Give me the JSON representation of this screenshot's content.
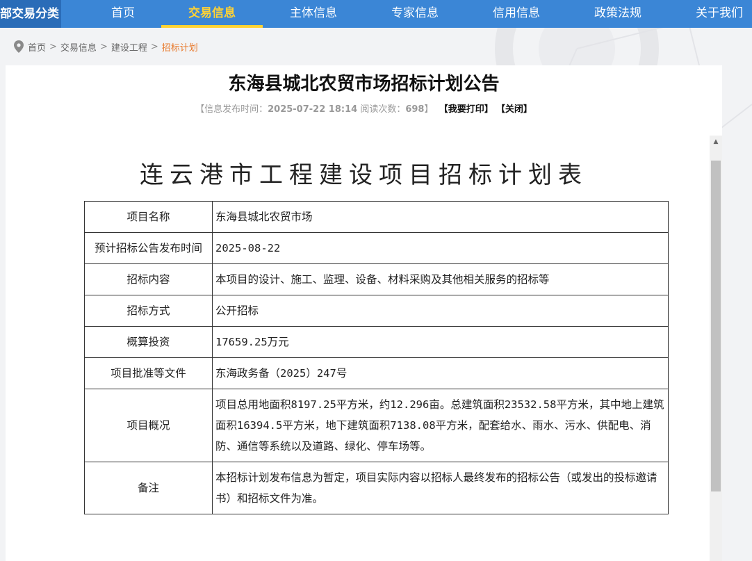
{
  "nav": {
    "category": "部交易分类",
    "items": [
      {
        "label": "首页",
        "active": false
      },
      {
        "label": "交易信息",
        "active": true
      },
      {
        "label": "主体信息",
        "active": false
      },
      {
        "label": "专家信息",
        "active": false
      },
      {
        "label": "信用信息",
        "active": false
      },
      {
        "label": "政策法规",
        "active": false
      },
      {
        "label": "关于我们",
        "active": false
      }
    ]
  },
  "breadcrumb": {
    "items": [
      "首页",
      "交易信息",
      "建设工程"
    ],
    "current": "招标计划",
    "separator": ">"
  },
  "article": {
    "title": "东海县城北农贸市场招标计划公告",
    "meta_open": "【",
    "publish_label": "信息发布时间：",
    "publish_time": "2025-07-22 18:14",
    "views_label": "阅读次数：",
    "views": "698",
    "meta_close": "】",
    "print_button": "【我要打印】",
    "close_button": "【关闭】"
  },
  "document": {
    "heading": "连云港市工程建设项目招标计划表",
    "rows": [
      {
        "key": "项目名称",
        "value": "东海县城北农贸市场"
      },
      {
        "key": "预计招标公告发布时间",
        "value": "2025-08-22"
      },
      {
        "key": "招标内容",
        "value": "本项目的设计、施工、监理、设备、材料采购及其他相关服务的招标等"
      },
      {
        "key": "招标方式",
        "value": "公开招标"
      },
      {
        "key": "概算投资",
        "value": "17659.25万元"
      },
      {
        "key": "项目批准等文件",
        "value": "东海政务备（2025）247号"
      },
      {
        "key": "项目概况",
        "value": "项目总用地面积8197.25平方米，约12.296亩。总建筑面积23532.58平方米，其中地上建筑面积16394.5平方米，地下建筑面积7138.08平方米，配套给水、雨水、污水、供配电、消防、通信等系统以及道路、绿化、停车场等。"
      },
      {
        "key": "备注",
        "value": "本招标计划发布信息为暂定，项目实际内容以招标人最终发布的招标公告（或发出的投标邀请书）和招标文件为准。"
      }
    ]
  },
  "colors": {
    "nav_bg": "#3b86d6",
    "nav_active": "#ffd235",
    "crumb_current": "#e8782a"
  },
  "icons": {
    "location": "location-pin-icon",
    "scroll_up": "arrow-up-icon"
  }
}
